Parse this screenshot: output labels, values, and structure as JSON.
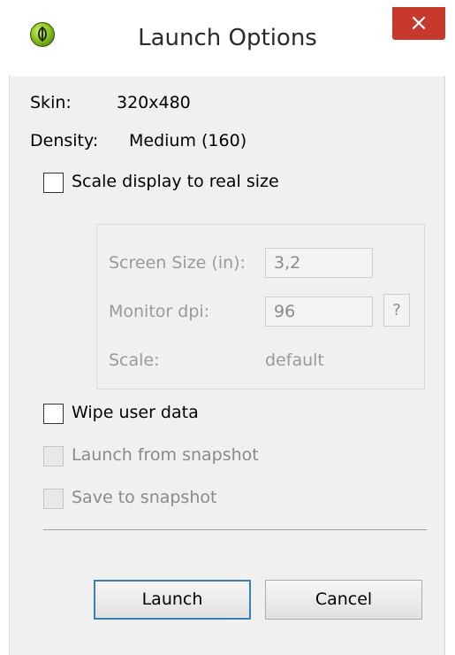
{
  "window": {
    "title": "Launch Options",
    "close_glyph": "×"
  },
  "icons": {
    "app": "android-app-icon",
    "close": "close-icon"
  },
  "info": {
    "skin_label": "Skin:",
    "skin_value": "320x480",
    "density_label": "Density:",
    "density_value": "Medium (160)"
  },
  "scale_display": {
    "label": "Scale display to real size",
    "checked": false
  },
  "scale_group": {
    "screen_size_label": "Screen Size (in):",
    "screen_size_value": "3,2",
    "monitor_dpi_label": "Monitor dpi:",
    "monitor_dpi_value": "96",
    "help_label": "?",
    "scale_label": "Scale:",
    "scale_value": "default",
    "enabled": false
  },
  "options": {
    "wipe_user_data": {
      "label": "Wipe user data",
      "checked": false,
      "enabled": true
    },
    "launch_from_snapshot": {
      "label": "Launch from snapshot",
      "checked": false,
      "enabled": false
    },
    "save_to_snapshot": {
      "label": "Save to snapshot",
      "checked": false,
      "enabled": false
    }
  },
  "buttons": {
    "launch": "Launch",
    "cancel": "Cancel"
  },
  "colors": {
    "close_button": "#c7382d",
    "dialog_bg": "#f0f0f0",
    "default_button_border": "#3c7fb1"
  }
}
